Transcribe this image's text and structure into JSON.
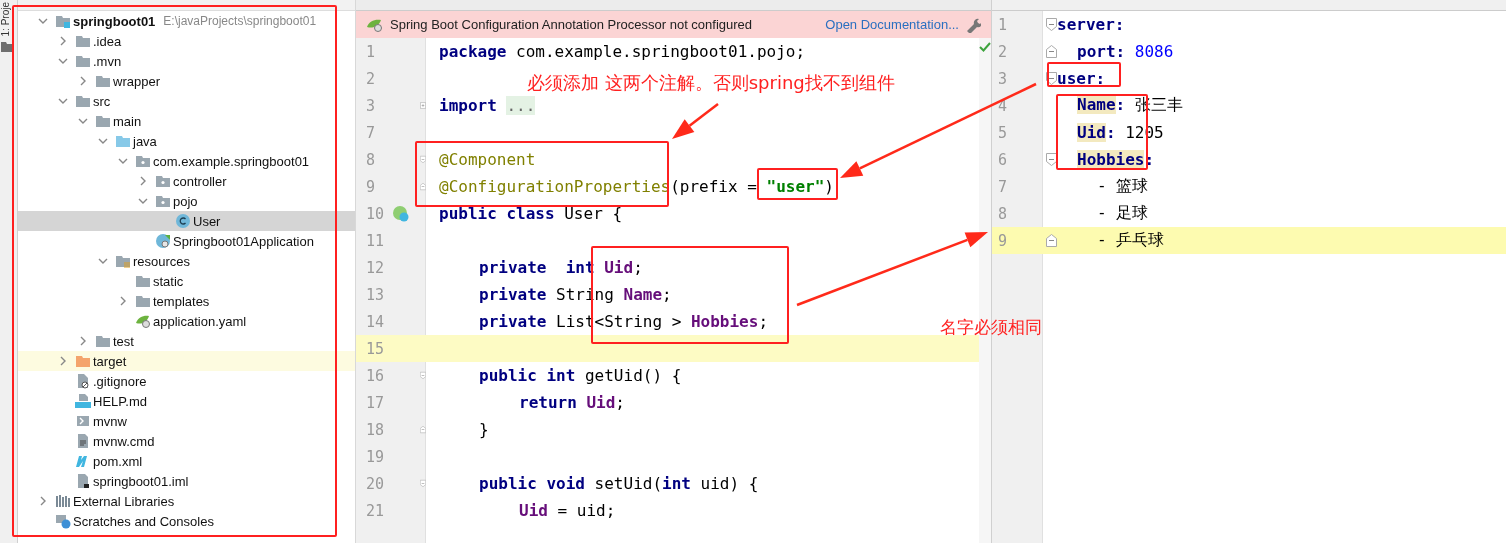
{
  "tool_window_strip": {
    "label": "1: Proje"
  },
  "project_tree": {
    "items": [
      {
        "label": "springboot01",
        "path": "E:\\javaProjects\\springboot01",
        "kind": "module",
        "expanded": true,
        "selected": false,
        "highlighted": false,
        "children": [
          {
            "label": ".idea",
            "kind": "folder",
            "expanded": false,
            "selected": false,
            "highlighted": false
          },
          {
            "label": ".mvn",
            "kind": "folder",
            "expanded": true,
            "selected": false,
            "highlighted": false,
            "children": [
              {
                "label": "wrapper",
                "kind": "folder",
                "expanded": false,
                "selected": false,
                "highlighted": false
              }
            ]
          },
          {
            "label": "src",
            "kind": "folder",
            "expanded": true,
            "selected": false,
            "highlighted": false,
            "children": [
              {
                "label": "main",
                "kind": "folder",
                "expanded": true,
                "selected": false,
                "highlighted": false,
                "children": [
                  {
                    "label": "java",
                    "kind": "source-folder",
                    "expanded": true,
                    "selected": false,
                    "highlighted": false,
                    "children": [
                      {
                        "label": "com.example.springboot01",
                        "kind": "package",
                        "expanded": true,
                        "selected": false,
                        "highlighted": false,
                        "children": [
                          {
                            "label": "controller",
                            "kind": "package",
                            "expanded": false,
                            "selected": false,
                            "highlighted": false
                          },
                          {
                            "label": "pojo",
                            "kind": "package",
                            "expanded": true,
                            "selected": false,
                            "highlighted": false,
                            "children": [
                              {
                                "label": "User",
                                "kind": "class",
                                "selected": true,
                                "highlighted": false
                              }
                            ]
                          },
                          {
                            "label": "Springboot01Application",
                            "kind": "spring-class",
                            "selected": false,
                            "highlighted": false
                          }
                        ]
                      }
                    ]
                  },
                  {
                    "label": "resources",
                    "kind": "resources-folder",
                    "expanded": true,
                    "selected": false,
                    "highlighted": false,
                    "children": [
                      {
                        "label": "static",
                        "kind": "folder",
                        "selected": false,
                        "highlighted": false
                      },
                      {
                        "label": "templates",
                        "kind": "folder",
                        "expanded": false,
                        "selected": false,
                        "highlighted": false
                      },
                      {
                        "label": "application.yaml",
                        "kind": "yaml-file",
                        "selected": false,
                        "highlighted": false
                      }
                    ]
                  }
                ]
              },
              {
                "label": "test",
                "kind": "folder",
                "expanded": false,
                "selected": false,
                "highlighted": false
              }
            ]
          },
          {
            "label": "target",
            "kind": "excluded-folder",
            "expanded": false,
            "selected": false,
            "highlighted": true
          },
          {
            "label": ".gitignore",
            "kind": "ignore-file",
            "selected": false,
            "highlighted": false
          },
          {
            "label": "HELP.md",
            "kind": "markdown-file",
            "selected": false,
            "highlighted": false
          },
          {
            "label": "mvnw",
            "kind": "script-file",
            "selected": false,
            "highlighted": false
          },
          {
            "label": "mvnw.cmd",
            "kind": "text-file",
            "selected": false,
            "highlighted": false
          },
          {
            "label": "pom.xml",
            "kind": "maven-file",
            "selected": false,
            "highlighted": false
          },
          {
            "label": "springboot01.iml",
            "kind": "module-file",
            "selected": false,
            "highlighted": false
          }
        ]
      },
      {
        "label": "External Libraries",
        "kind": "libraries",
        "expanded": false,
        "selected": false,
        "highlighted": false
      },
      {
        "label": "Scratches and Consoles",
        "kind": "scratches",
        "selected": false,
        "highlighted": false
      }
    ]
  },
  "java_editor": {
    "banner": {
      "message": "Spring Boot Configuration Annotation Processor not configured",
      "link": "Open Documentation..."
    },
    "lines": [
      {
        "n": "1",
        "current": false,
        "tokens": [
          {
            "kind": "kw",
            "text": "package"
          },
          {
            "kind": "plain",
            "text": " com.example.springboot01.pojo;"
          }
        ]
      },
      {
        "n": "2",
        "current": false
      },
      {
        "n": "3",
        "kind": "folded",
        "current": false,
        "tokens": [
          {
            "kind": "kw",
            "text": "import"
          },
          {
            "kind": "folded",
            "text": "..."
          }
        ]
      },
      {
        "n": "7",
        "current": false
      },
      {
        "n": "8",
        "kind": "fold-start",
        "current": false,
        "tokens": [
          {
            "kind": "ann",
            "text": "@Component"
          }
        ]
      },
      {
        "n": "9",
        "kind": "fold-end",
        "current": false,
        "tokens": [
          {
            "kind": "ann",
            "text": "@ConfigurationProperties"
          },
          {
            "kind": "plain",
            "text": "(prefix = "
          },
          {
            "kind": "str",
            "text": "\"user\""
          },
          {
            "kind": "plain",
            "text": ")"
          }
        ]
      },
      {
        "n": "10",
        "kind": "bean",
        "current": false,
        "tokens": [
          {
            "kind": "kw",
            "text": "public class"
          },
          {
            "kind": "plain",
            "text": " User {"
          }
        ],
        "children": [
          {
            "n": "11",
            "current": false
          },
          {
            "n": "12",
            "current": false,
            "tokens": [
              {
                "kind": "kw",
                "text": "private  int "
              },
              {
                "kind": "field",
                "text": "Uid"
              },
              {
                "kind": "plain",
                "text": ";"
              }
            ]
          },
          {
            "n": "13",
            "current": false,
            "tokens": [
              {
                "kind": "kw",
                "text": "private"
              },
              {
                "kind": "plain",
                "text": " String "
              },
              {
                "kind": "field",
                "text": "Name"
              },
              {
                "kind": "plain",
                "text": ";"
              }
            ]
          },
          {
            "n": "14",
            "current": false,
            "tokens": [
              {
                "kind": "kw",
                "text": "private"
              },
              {
                "kind": "plain",
                "text": " List<String > "
              },
              {
                "kind": "field",
                "text": "Hobbies"
              },
              {
                "kind": "plain",
                "text": ";"
              }
            ]
          },
          {
            "n": "15",
            "current": true
          },
          {
            "n": "16",
            "kind": "fold-start",
            "current": false,
            "tokens": [
              {
                "kind": "kw",
                "text": "public int"
              },
              {
                "kind": "plain",
                "text": " getUid() {"
              }
            ],
            "children": [
              {
                "n": "17",
                "current": false,
                "tokens": [
                  {
                    "kind": "kw",
                    "text": "return "
                  },
                  {
                    "kind": "field",
                    "text": "Uid"
                  },
                  {
                    "kind": "plain",
                    "text": ";"
                  }
                ]
              }
            ]
          },
          {
            "n": "18",
            "kind": "fold-end",
            "current": false,
            "tokens": [
              {
                "kind": "plain",
                "text": "}"
              }
            ]
          },
          {
            "n": "19",
            "current": false
          },
          {
            "n": "20",
            "kind": "fold-start",
            "current": false,
            "tokens": [
              {
                "kind": "kw",
                "text": "public void"
              },
              {
                "kind": "plain",
                "text": " setUid("
              },
              {
                "kind": "kw",
                "text": "int"
              },
              {
                "kind": "plain",
                "text": " uid) {"
              }
            ],
            "children": [
              {
                "n": "21",
                "current": false,
                "tokens": [
                  {
                    "kind": "field",
                    "text": "Uid"
                  },
                  {
                    "kind": "plain",
                    "text": " = uid;"
                  }
                ]
              }
            ]
          }
        ]
      }
    ]
  },
  "yaml_editor": {
    "lines": [
      {
        "n": "1",
        "kind": "fold-start",
        "current": false,
        "tokens": [
          {
            "kind": "key",
            "text": "server:"
          }
        ],
        "children": [
          {
            "n": "2",
            "kind": "fold-end",
            "current": false,
            "tokens": [
              {
                "kind": "key",
                "text": "port:"
              },
              {
                "kind": "num",
                "text": " 8086"
              }
            ]
          }
        ]
      },
      {
        "n": "3",
        "kind": "fold-start",
        "current": false,
        "tokens": [
          {
            "kind": "key",
            "text": "user:"
          }
        ],
        "children": [
          {
            "n": "4",
            "current": false,
            "tokens": [
              {
                "kind": "key-match",
                "text": "Name"
              },
              {
                "kind": "key",
                "text": ":"
              },
              {
                "kind": "plain",
                "text": " 张三丰"
              }
            ]
          },
          {
            "n": "5",
            "current": false,
            "tokens": [
              {
                "kind": "key-match",
                "text": "Uid"
              },
              {
                "kind": "key",
                "text": ":"
              },
              {
                "kind": "plain",
                "text": " 1205"
              }
            ]
          },
          {
            "n": "6",
            "kind": "fold-start",
            "current": false,
            "tokens": [
              {
                "kind": "key-match",
                "text": "Hobbies"
              },
              {
                "kind": "key",
                "text": ":"
              }
            ],
            "children": [
              {
                "n": "7",
                "current": false,
                "tokens": [
                  {
                    "kind": "plain",
                    "text": "- 篮球"
                  }
                ]
              },
              {
                "n": "8",
                "current": false,
                "tokens": [
                  {
                    "kind": "plain",
                    "text": "- 足球"
                  }
                ]
              },
              {
                "n": "9",
                "kind": "fold-end",
                "current": true,
                "tokens": [
                  {
                    "kind": "plain",
                    "text": "- 乒乓球"
                  }
                ]
              }
            ]
          }
        ]
      }
    ]
  },
  "annotations": [
    {
      "text": "必须添加 这两个注解。否则spring找不到组件"
    },
    {
      "text": "名字必须相同"
    }
  ]
}
